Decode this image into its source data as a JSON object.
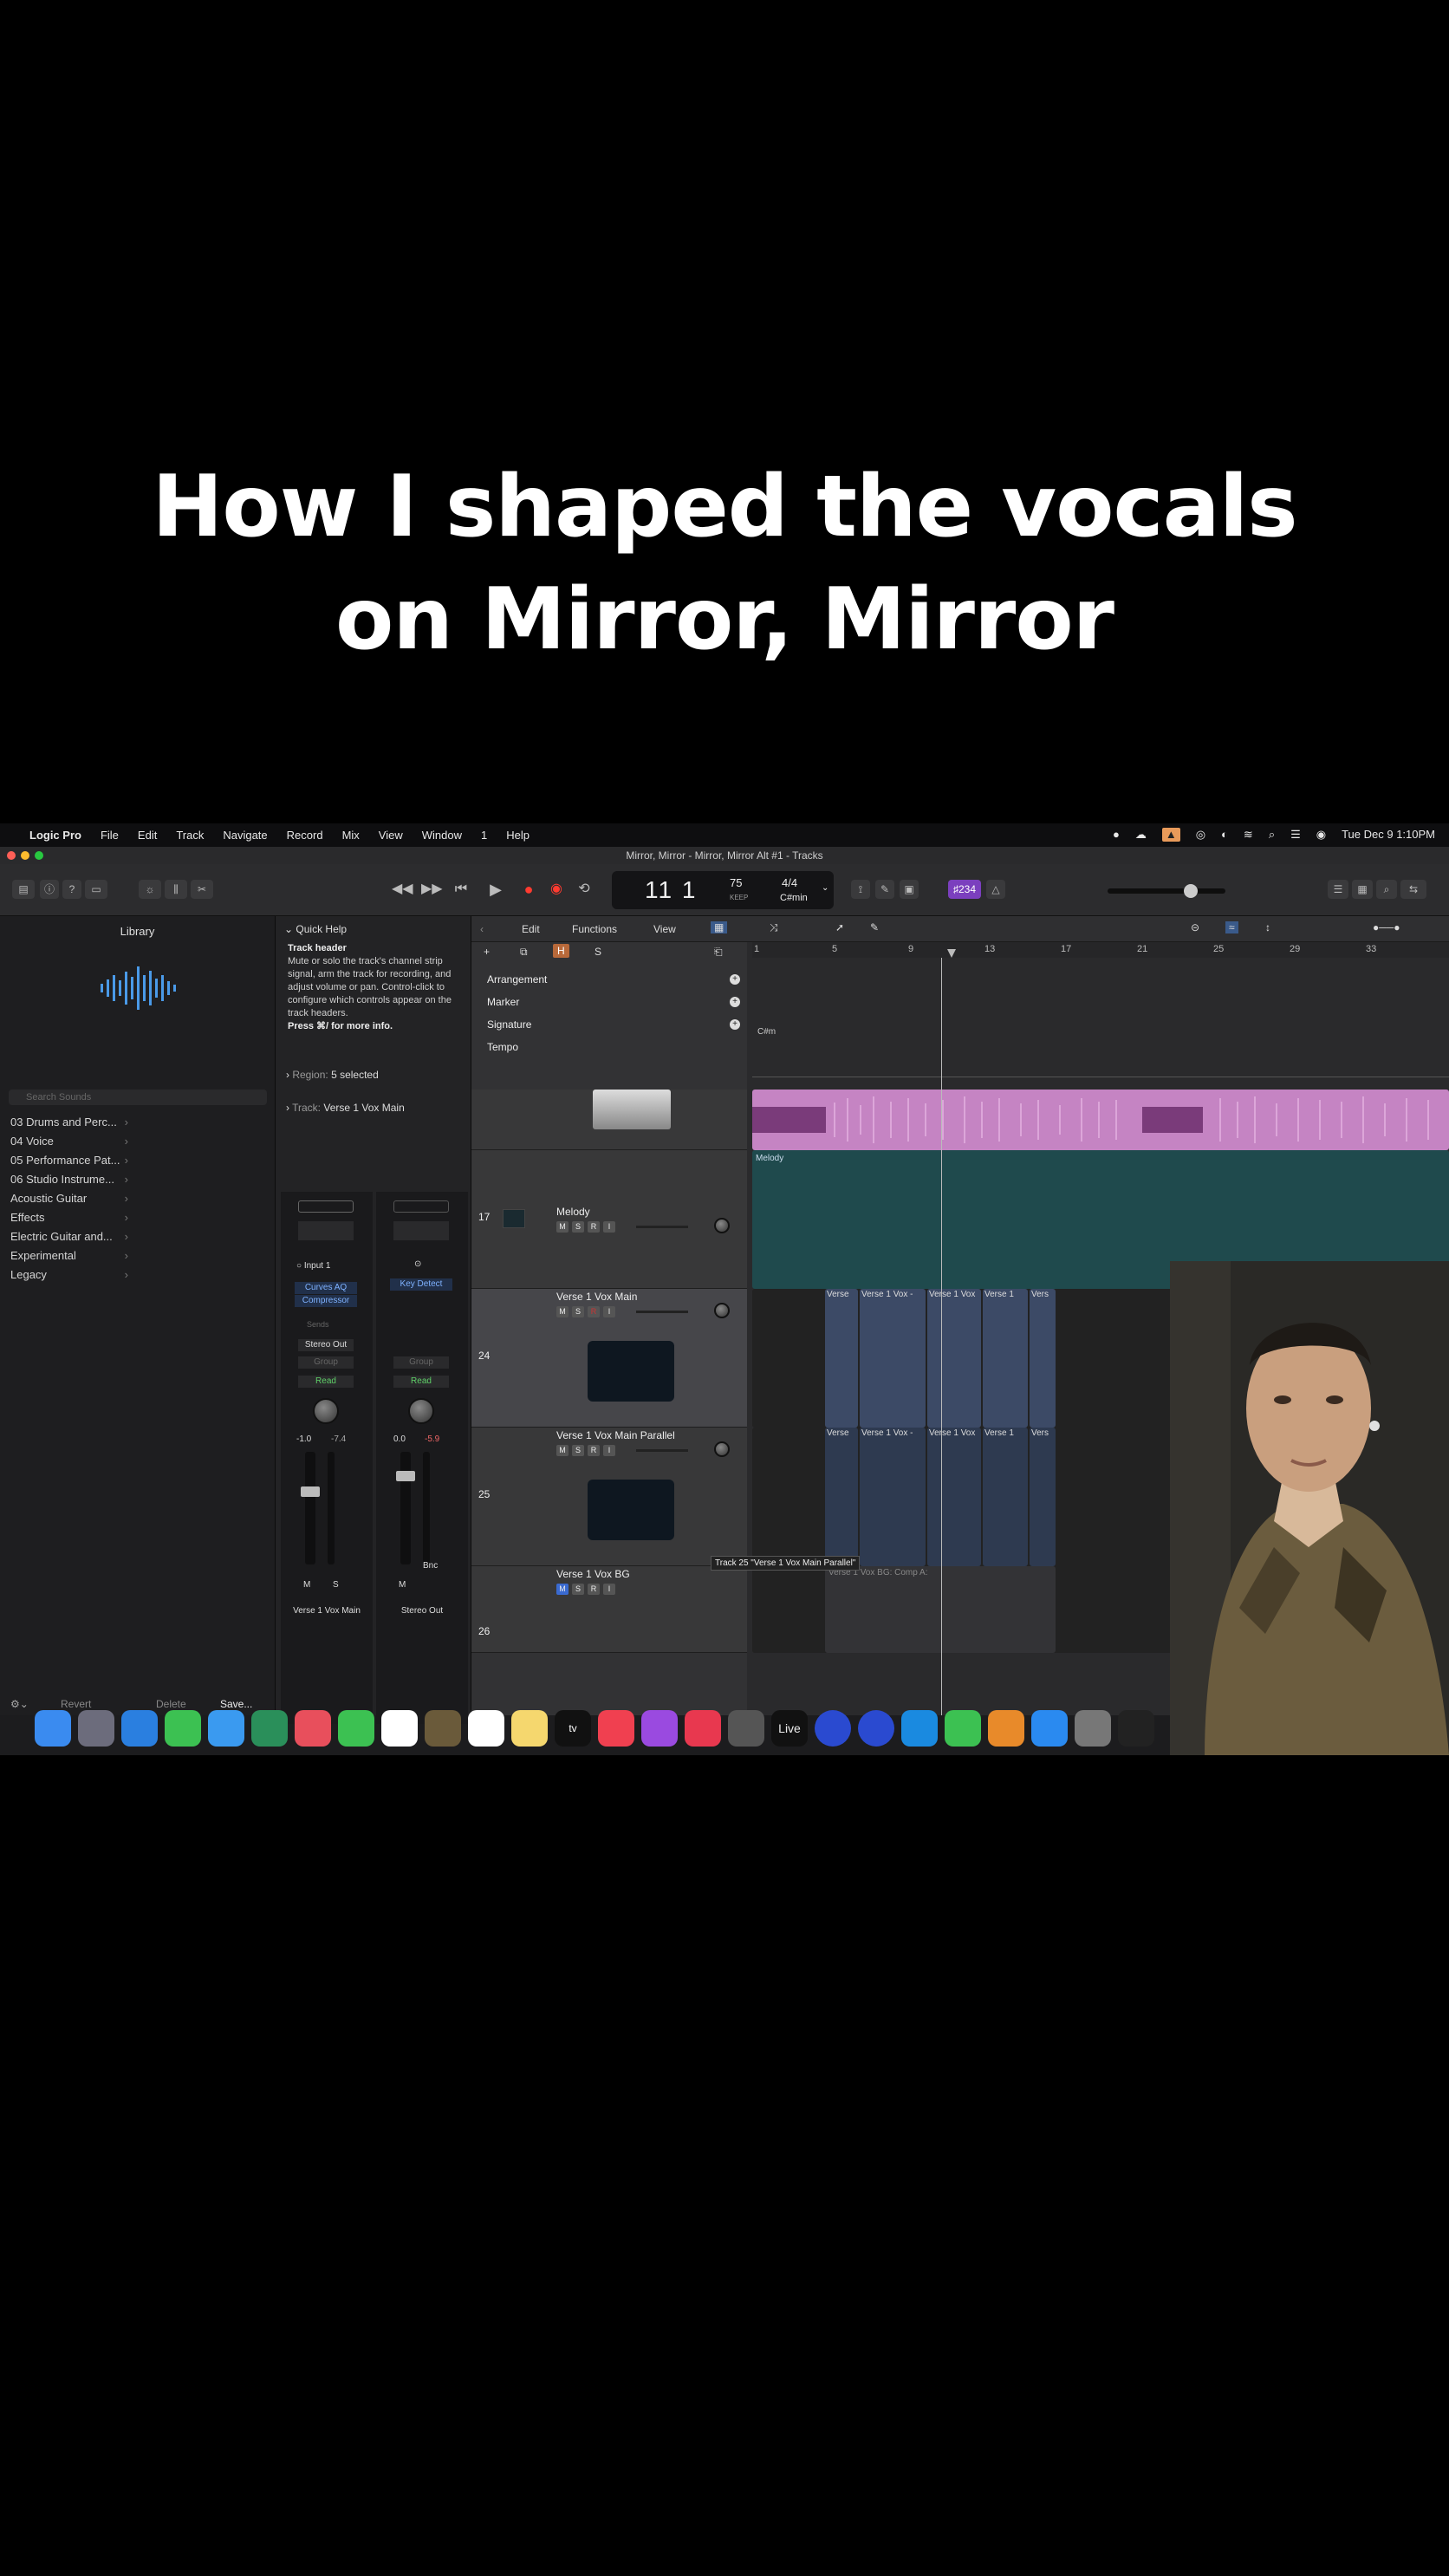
{
  "caption": {
    "line1": "How I shaped the vocals",
    "line2": "on Mirror, Mirror"
  },
  "menubar": {
    "app": "Logic Pro",
    "items": [
      "File",
      "Edit",
      "Track",
      "Navigate",
      "Record",
      "Mix",
      "View",
      "Window",
      "1",
      "Help"
    ],
    "clock": "Tue Dec 9  1:10PM"
  },
  "window_title": "Mirror, Mirror - Mirror, Mirror Alt #1 - Tracks",
  "lcd": {
    "position": "11 1",
    "bpm": "75",
    "keep": "KEEP",
    "signature": "4/4",
    "key": "C#min"
  },
  "badge": "♯234",
  "library": {
    "title": "Library",
    "search_placeholder": "Search Sounds",
    "items": [
      "03 Drums and Perc...",
      "04 Voice",
      "05 Performance Pat...",
      "06 Studio Instrume...",
      "Acoustic Guitar",
      "Effects",
      "Electric Guitar and...",
      "Experimental",
      "Legacy"
    ],
    "footer": {
      "revert": "Revert",
      "delete": "Delete",
      "save": "Save..."
    }
  },
  "quick_help": {
    "title": "Quick Help",
    "heading": "Track header",
    "body": "Mute or solo the track's channel strip signal, arm the track for recording, and adjust volume or pan. Control-click to configure which controls appear on the track headers.",
    "more": "Press ⌘/ for more info.",
    "region_label": "Region:",
    "region_value": "5 selected",
    "track_label": "Track:",
    "track_value": "Verse 1 Vox Main"
  },
  "strips": [
    {
      "input": "Input 1",
      "plugins": [
        "Curves AQ",
        "Compressor"
      ],
      "sends": "Sends",
      "output": "Stereo Out",
      "group": "Group",
      "auto": "Read",
      "vol": "-1.0",
      "peak": "-7.4",
      "name": "Verse 1 Vox Main"
    },
    {
      "input": "",
      "plugins": [
        "Key Detect"
      ],
      "sends": "",
      "output": "",
      "group": "Group",
      "auto": "Read",
      "vol": "0.0",
      "peak": "-5.9",
      "name": "Stereo Out",
      "bnc": "Bnc"
    }
  ],
  "edit_bar": {
    "edit": "Edit",
    "functions": "Functions",
    "view": "View"
  },
  "ruler": [
    "1",
    "5",
    "9",
    "13",
    "17",
    "21",
    "25",
    "29",
    "33"
  ],
  "global_tracks": [
    "Arrangement",
    "Marker",
    "Signature",
    "Tempo"
  ],
  "signature_key": "C#m",
  "tracks": [
    {
      "num": "17",
      "name": "Melody",
      "region": "Melody"
    },
    {
      "num": "24",
      "name": "Verse 1 Vox Main",
      "regions": [
        "Verse",
        "Verse 1 Vox -",
        "Verse 1 Vox",
        "Verse 1",
        "Vers"
      ]
    },
    {
      "num": "25",
      "name": "Verse 1 Vox Main Parallel",
      "regions": [
        "Verse",
        "Verse 1 Vox -",
        "Verse 1 Vox",
        "Verse 1",
        "Vers"
      ]
    },
    {
      "num": "26",
      "name": "Verse 1 Vox BG",
      "regions": [
        "Verse 1 Vox BG: Comp A:"
      ]
    }
  ],
  "tooltip": "Track 25 \"Verse 1 Vox Main Parallel\"",
  "mute_labels": {
    "m": "M",
    "s": "S",
    "r": "R",
    "i": "I"
  },
  "dock_live": "Live",
  "colors": {
    "accent": "#3a7ee8",
    "region_pink": "#d79ad6",
    "region_teal": "#1f4a4d",
    "region_blue": "#5d6e8c"
  }
}
